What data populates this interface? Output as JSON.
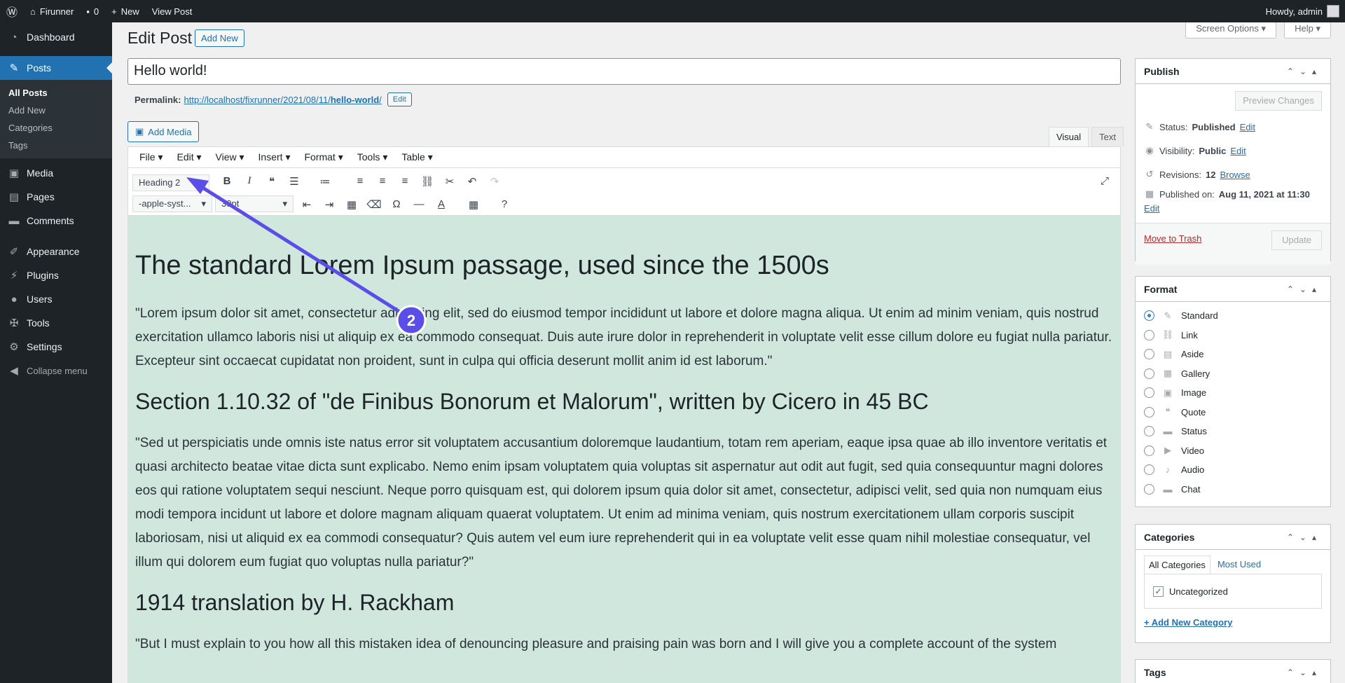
{
  "adminbar": {
    "site": "Firunner",
    "comments": "0",
    "new": "New",
    "view": "View Post",
    "howdy": "Howdy, admin"
  },
  "sidebar": {
    "dashboard": "Dashboard",
    "posts": "Posts",
    "sub": [
      "All Posts",
      "Add New",
      "Categories",
      "Tags"
    ],
    "media": "Media",
    "pages": "Pages",
    "comments": "Comments",
    "appearance": "Appearance",
    "plugins": "Plugins",
    "users": "Users",
    "tools": "Tools",
    "settings": "Settings",
    "collapse": "Collapse menu"
  },
  "header": {
    "title": "Edit Post",
    "add_new": "Add New",
    "screen_options": "Screen Options ▾",
    "help": "Help ▾"
  },
  "post": {
    "title": "Hello world!",
    "permalink_label": "Permalink:",
    "permalink_base": "http://localhost/fixrunner/2021/08/11/",
    "permalink_slug": "hello-world",
    "permalink_end": "/",
    "edit": "Edit"
  },
  "editor": {
    "add_media": "Add Media",
    "tab_visual": "Visual",
    "tab_text": "Text",
    "menus": [
      "File ▾",
      "Edit ▾",
      "View ▾",
      "Insert ▾",
      "Format ▾",
      "Tools ▾",
      "Table ▾"
    ],
    "block_format": "Heading 2",
    "font_family": "-apple-syst...",
    "font_size": "30pt",
    "h2": "The standard Lorem Ipsum passage, used since the 1500s",
    "p1": "\"Lorem ipsum dolor sit amet, consectetur adipiscing elit, sed do eiusmod tempor incididunt ut labore et dolore magna aliqua. Ut enim ad minim veniam, quis nostrud exercitation ullamco laboris nisi ut aliquip ex ea commodo consequat. Duis aute irure dolor in reprehenderit in voluptate velit esse cillum dolore eu fugiat nulla pariatur. Excepteur sint occaecat cupidatat non proident, sunt in culpa qui officia deserunt mollit anim id est laborum.\"",
    "h3a": "Section 1.10.32 of \"de Finibus Bonorum et Malorum\", written by Cicero in 45 BC",
    "p2": "\"Sed ut perspiciatis unde omnis iste natus error sit voluptatem accusantium doloremque laudantium, totam rem aperiam, eaque ipsa quae ab illo inventore veritatis et quasi architecto beatae vitae dicta sunt explicabo. Nemo enim ipsam voluptatem quia voluptas sit aspernatur aut odit aut fugit, sed quia consequuntur magni dolores eos qui ratione voluptatem sequi nesciunt. Neque porro quisquam est, qui dolorem ipsum quia dolor sit amet, consectetur, adipisci velit, sed quia non numquam eius modi tempora incidunt ut labore et dolore magnam aliquam quaerat voluptatem. Ut enim ad minima veniam, quis nostrum exercitationem ullam corporis suscipit laboriosam, nisi ut aliquid ex ea commodi consequatur? Quis autem vel eum iure reprehenderit qui in ea voluptate velit esse quam nihil molestiae consequatur, vel illum qui dolorem eum fugiat quo voluptas nulla pariatur?\"",
    "h3b": "1914 translation by H. Rackham",
    "p3": "\"But I must explain to you how all this mistaken idea of denouncing pleasure and praising pain was born and I will give you a complete account of the system"
  },
  "publish": {
    "title": "Publish",
    "preview": "Preview Changes",
    "status_l": "Status:",
    "status_v": "Published",
    "vis_l": "Visibility:",
    "vis_v": "Public",
    "rev_l": "Revisions:",
    "rev_v": "12",
    "browse": "Browse",
    "pub_l": "Published on:",
    "pub_v": "Aug 11, 2021 at 11:30",
    "edit": "Edit",
    "trash": "Move to Trash",
    "update": "Update"
  },
  "format": {
    "title": "Format",
    "options": [
      "Standard",
      "Link",
      "Aside",
      "Gallery",
      "Image",
      "Quote",
      "Status",
      "Video",
      "Audio",
      "Chat"
    ],
    "selected": "Standard"
  },
  "categories": {
    "title": "Categories",
    "tab_all": "All Categories",
    "tab_used": "Most Used",
    "items": [
      "Uncategorized"
    ],
    "add": "+ Add New Category"
  },
  "tags": {
    "title": "Tags"
  },
  "annotation": {
    "step": "2",
    "color": "#5b4de8"
  }
}
